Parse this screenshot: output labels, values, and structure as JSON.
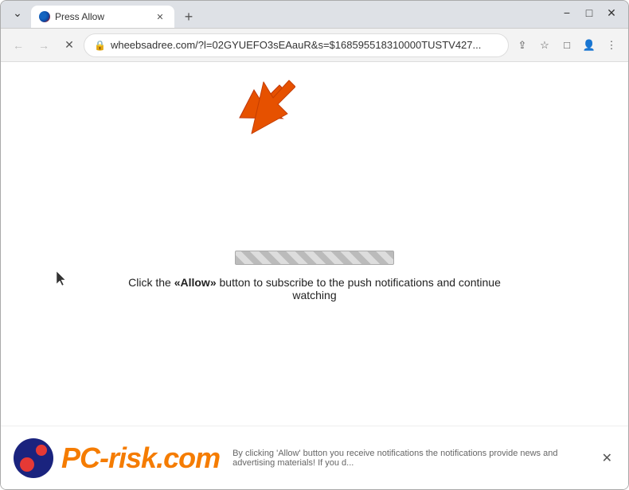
{
  "window": {
    "title": "Press Allow",
    "favicon": "browser-icon"
  },
  "titlebar": {
    "tab_label": "Press Allow",
    "new_tab_label": "+",
    "chevron_label": "⌄",
    "minimize_label": "−",
    "restore_label": "□",
    "close_label": "✕"
  },
  "addressbar": {
    "back_label": "←",
    "forward_label": "→",
    "reload_label": "✕",
    "url": "wheebsadree.com/?l=02GYUEFO3sEAauR&s=$168595518310000TUSTV427...",
    "lock_icon": "🔒",
    "share_label": "⇪",
    "bookmark_label": "☆",
    "extension_label": "□",
    "profile_label": "👤",
    "menu_label": "⋮"
  },
  "page": {
    "arrow_present": true,
    "progress_bar_present": true,
    "main_text": "Click the «Allow» button to subscribe to the push notifications and continue watching"
  },
  "watermark": {
    "logo_text_pc": "PC",
    "logo_text_risk": "risk",
    "logo_tld": ".com",
    "description": "By clicking 'Allow' button you receive notifications the notifications provide news and advertising materials! If you d..."
  }
}
